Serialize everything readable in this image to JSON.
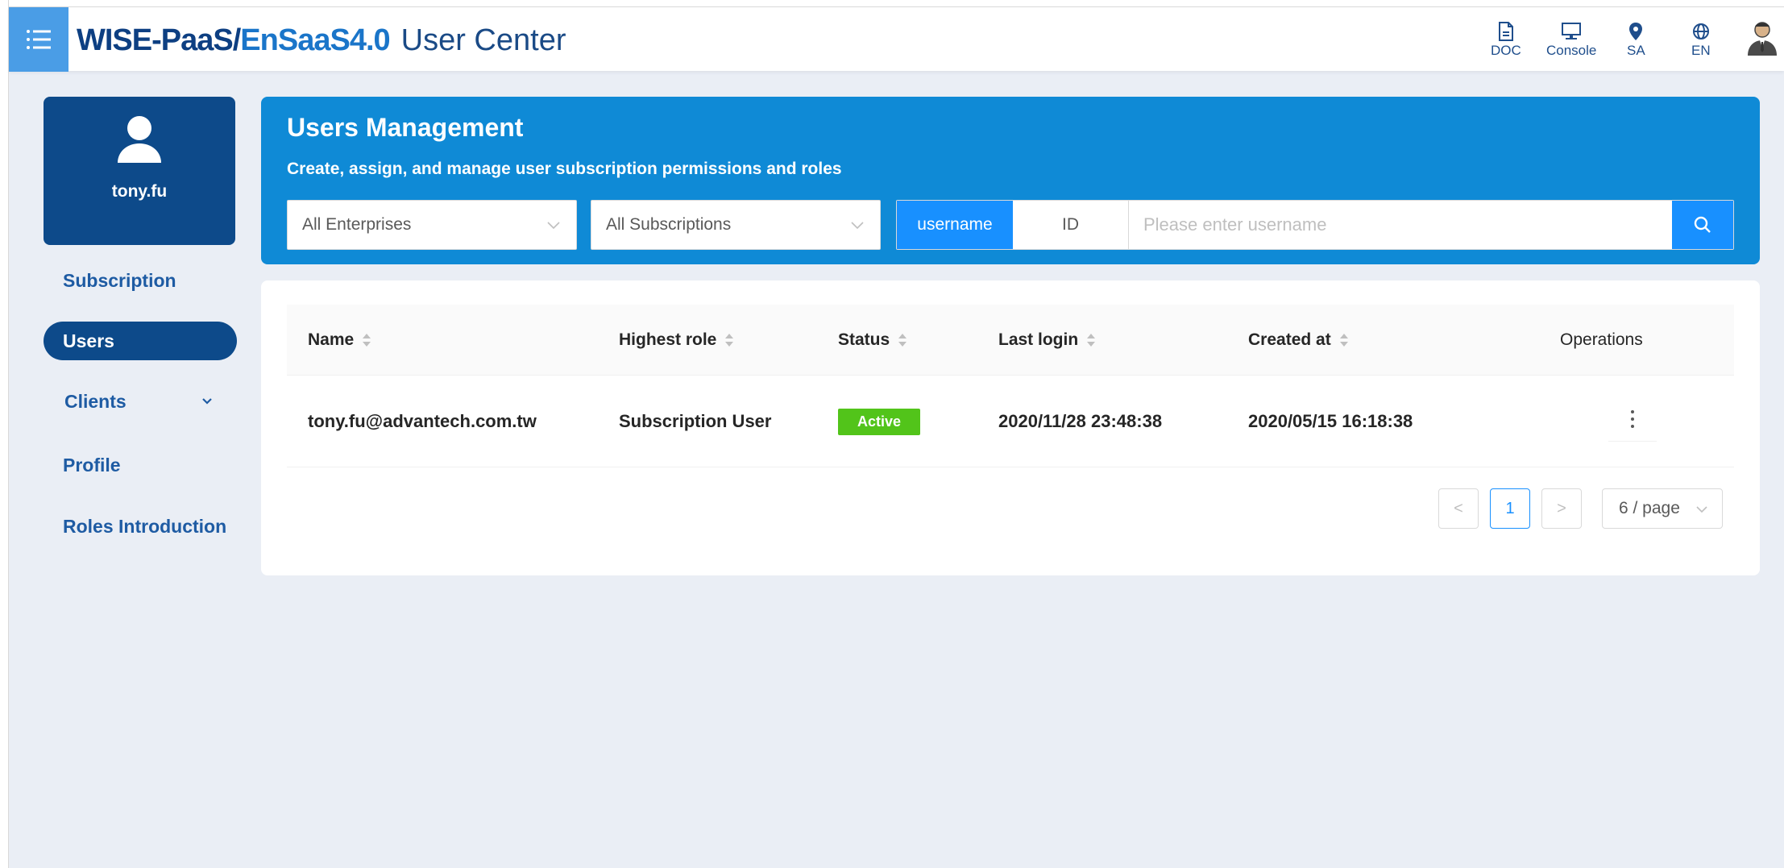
{
  "header": {
    "brand_part1": "WISE-PaaS/",
    "brand_part2": "EnSaaS4.0",
    "brand_part3": "User Center",
    "items": [
      {
        "label": "DOC",
        "icon": "doc-icon"
      },
      {
        "label": "Console",
        "icon": "monitor-icon"
      },
      {
        "label": "SA",
        "icon": "location-pin-icon"
      },
      {
        "label": "EN",
        "icon": "globe-icon"
      }
    ],
    "avatar_icon": "user-avatar-icon"
  },
  "sidebar": {
    "username": "tony.fu",
    "items": [
      {
        "label": "Subscription",
        "active": false
      },
      {
        "label": "Users",
        "active": true
      },
      {
        "label": "Clients",
        "active": false,
        "expandable": true
      },
      {
        "label": "Profile",
        "active": false
      },
      {
        "label": "Roles Introduction",
        "active": false
      }
    ]
  },
  "management": {
    "title": "Users Management",
    "subtitle": "Create, assign, and manage user subscription permissions and roles",
    "enterprise_select": "All Enterprises",
    "subscription_select": "All Subscriptions",
    "search_modes": [
      "username",
      "ID"
    ],
    "active_search_mode": "username",
    "search_placeholder": "Please enter username"
  },
  "table": {
    "columns": [
      "Name",
      "Highest role",
      "Status",
      "Last login",
      "Created at",
      "Operations"
    ],
    "rows": [
      {
        "name": "tony.fu@advantech.com.tw",
        "role": "Subscription User",
        "status": "Active",
        "last_login": "2020/11/28 23:48:38",
        "created_at": "2020/05/15 16:18:38"
      }
    ]
  },
  "pagination": {
    "prev": "<",
    "current_page": "1",
    "next": ">",
    "page_size": "6 / page"
  },
  "colors": {
    "brand_dark": "#0d3f82",
    "brand_light": "#1a75c9",
    "panel_blue": "#0f8ad6",
    "primary": "#1890ff",
    "nav_dark": "#0d4a8a",
    "status_active": "#52c41a"
  }
}
